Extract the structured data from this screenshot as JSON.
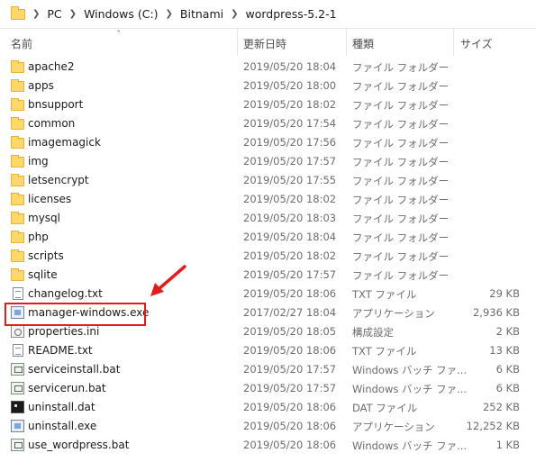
{
  "address_bar": {
    "path": [
      "PC",
      "Windows (C:)",
      "Bitnami",
      "wordpress-5.2-1"
    ],
    "separator": ">"
  },
  "columns": {
    "name": "名前",
    "date": "更新日時",
    "type": "種類",
    "size": "サイズ"
  },
  "files": [
    {
      "name": "apache2",
      "date": "2019/05/20 18:04",
      "type": "ファイル フォルダー",
      "size": "",
      "icon": "folder-icon"
    },
    {
      "name": "apps",
      "date": "2019/05/20 18:00",
      "type": "ファイル フォルダー",
      "size": "",
      "icon": "folder-icon"
    },
    {
      "name": "bnsupport",
      "date": "2019/05/20 18:02",
      "type": "ファイル フォルダー",
      "size": "",
      "icon": "folder-icon"
    },
    {
      "name": "common",
      "date": "2019/05/20 17:54",
      "type": "ファイル フォルダー",
      "size": "",
      "icon": "folder-icon"
    },
    {
      "name": "imagemagick",
      "date": "2019/05/20 17:56",
      "type": "ファイル フォルダー",
      "size": "",
      "icon": "folder-icon"
    },
    {
      "name": "img",
      "date": "2019/05/20 17:57",
      "type": "ファイル フォルダー",
      "size": "",
      "icon": "folder-icon"
    },
    {
      "name": "letsencrypt",
      "date": "2019/05/20 17:55",
      "type": "ファイル フォルダー",
      "size": "",
      "icon": "folder-icon"
    },
    {
      "name": "licenses",
      "date": "2019/05/20 18:02",
      "type": "ファイル フォルダー",
      "size": "",
      "icon": "folder-icon"
    },
    {
      "name": "mysql",
      "date": "2019/05/20 18:03",
      "type": "ファイル フォルダー",
      "size": "",
      "icon": "folder-icon"
    },
    {
      "name": "php",
      "date": "2019/05/20 18:04",
      "type": "ファイル フォルダー",
      "size": "",
      "icon": "folder-icon"
    },
    {
      "name": "scripts",
      "date": "2019/05/20 18:02",
      "type": "ファイル フォルダー",
      "size": "",
      "icon": "folder-icon"
    },
    {
      "name": "sqlite",
      "date": "2019/05/20 17:57",
      "type": "ファイル フォルダー",
      "size": "",
      "icon": "folder-icon"
    },
    {
      "name": "changelog.txt",
      "date": "2019/05/20 18:06",
      "type": "TXT ファイル",
      "size": "29 KB",
      "icon": "text-file-icon"
    },
    {
      "name": "manager-windows.exe",
      "date": "2017/02/27 18:04",
      "type": "アプリケーション",
      "size": "2,936 KB",
      "icon": "application-icon"
    },
    {
      "name": "properties.ini",
      "date": "2019/05/20 18:05",
      "type": "構成設定",
      "size": "2 KB",
      "icon": "settings-file-icon"
    },
    {
      "name": "README.txt",
      "date": "2019/05/20 18:06",
      "type": "TXT ファイル",
      "size": "13 KB",
      "icon": "text-file-icon"
    },
    {
      "name": "serviceinstall.bat",
      "date": "2019/05/20 17:57",
      "type": "Windows バッチ ファ...",
      "size": "6 KB",
      "icon": "batch-file-icon"
    },
    {
      "name": "servicerun.bat",
      "date": "2019/05/20 17:57",
      "type": "Windows バッチ ファ...",
      "size": "6 KB",
      "icon": "batch-file-icon"
    },
    {
      "name": "uninstall.dat",
      "date": "2019/05/20 18:06",
      "type": "DAT ファイル",
      "size": "252 KB",
      "icon": "dat-file-icon"
    },
    {
      "name": "uninstall.exe",
      "date": "2019/05/20 18:06",
      "type": "アプリケーション",
      "size": "12,252 KB",
      "icon": "application-icon"
    },
    {
      "name": "use_wordpress.bat",
      "date": "2019/05/20 18:06",
      "type": "Windows バッチ ファ...",
      "size": "1 KB",
      "icon": "batch-file-icon"
    }
  ],
  "highlight": {
    "target": "manager-windows.exe",
    "color": "#e11d1d"
  }
}
